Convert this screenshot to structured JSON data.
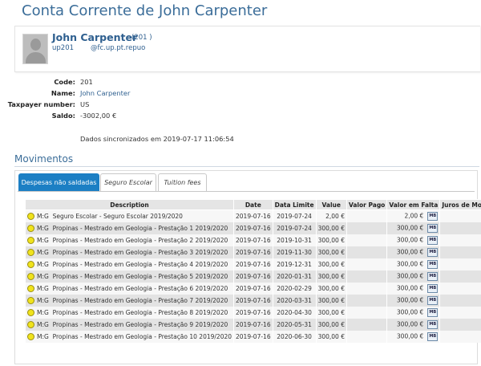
{
  "page": {
    "title": "Conta Corrente de John Carpenter"
  },
  "profile": {
    "name": "John Carpenter",
    "code": "(201          )",
    "user": "up201",
    "email": "@fc.up.pt.repuo"
  },
  "info": {
    "code_label": "Code:",
    "code_value": "201",
    "name_label": "Name:",
    "name_value": "John Carpenter",
    "tax_label": "Taxpayer number:",
    "tax_value": "US",
    "balance_label": "Saldo:",
    "balance_value": "-3002,00 €",
    "sync_text": "Dados sincronizados em 2019-07-17 11:06:54"
  },
  "movements": {
    "title": "Movimentos",
    "tabs": [
      {
        "label": "Despesas não saldadas"
      },
      {
        "label": "Seguro Escolar"
      },
      {
        "label": "Tuition fees"
      }
    ],
    "columns": [
      "Description",
      "Date",
      "Data Limite",
      "Value",
      "Valor Pago",
      "Valor em Falta",
      "Juros de Mora"
    ],
    "mb_label": "MB",
    "rows": [
      {
        "mg": "M:G",
        "desc": "Seguro Escolar - Seguro Escolar 2019/2020",
        "date": "2019-07-16",
        "limit": "2019-07-24",
        "value": "2,00 €",
        "paid": "",
        "missing": "2,00 €",
        "interest": ""
      },
      {
        "mg": "M:G",
        "desc": "Propinas - Mestrado em Geologia - Prestação 1 2019/2020",
        "date": "2019-07-16",
        "limit": "2019-07-24",
        "value": "300,00 €",
        "paid": "",
        "missing": "300,00 €",
        "interest": ""
      },
      {
        "mg": "M:G",
        "desc": "Propinas - Mestrado em Geologia - Prestação 2 2019/2020",
        "date": "2019-07-16",
        "limit": "2019-10-31",
        "value": "300,00 €",
        "paid": "",
        "missing": "300,00 €",
        "interest": ""
      },
      {
        "mg": "M:G",
        "desc": "Propinas - Mestrado em Geologia - Prestação 3 2019/2020",
        "date": "2019-07-16",
        "limit": "2019-11-30",
        "value": "300,00 €",
        "paid": "",
        "missing": "300,00 €",
        "interest": ""
      },
      {
        "mg": "M:G",
        "desc": "Propinas - Mestrado em Geologia - Prestação 4 2019/2020",
        "date": "2019-07-16",
        "limit": "2019-12-31",
        "value": "300,00 €",
        "paid": "",
        "missing": "300,00 €",
        "interest": ""
      },
      {
        "mg": "M:G",
        "desc": "Propinas - Mestrado em Geologia - Prestação 5 2019/2020",
        "date": "2019-07-16",
        "limit": "2020-01-31",
        "value": "300,00 €",
        "paid": "",
        "missing": "300,00 €",
        "interest": ""
      },
      {
        "mg": "M:G",
        "desc": "Propinas - Mestrado em Geologia - Prestação 6 2019/2020",
        "date": "2019-07-16",
        "limit": "2020-02-29",
        "value": "300,00 €",
        "paid": "",
        "missing": "300,00 €",
        "interest": ""
      },
      {
        "mg": "M:G",
        "desc": "Propinas - Mestrado em Geologia - Prestação 7 2019/2020",
        "date": "2019-07-16",
        "limit": "2020-03-31",
        "value": "300,00 €",
        "paid": "",
        "missing": "300,00 €",
        "interest": ""
      },
      {
        "mg": "M:G",
        "desc": "Propinas - Mestrado em Geologia - Prestação 8 2019/2020",
        "date": "2019-07-16",
        "limit": "2020-04-30",
        "value": "300,00 €",
        "paid": "",
        "missing": "300,00 €",
        "interest": ""
      },
      {
        "mg": "M:G",
        "desc": "Propinas - Mestrado em Geologia - Prestação 9 2019/2020",
        "date": "2019-07-16",
        "limit": "2020-05-31",
        "value": "300,00 €",
        "paid": "",
        "missing": "300,00 €",
        "interest": ""
      },
      {
        "mg": "M:G",
        "desc": "Propinas - Mestrado em Geologia - Prestação 10 2019/2020",
        "date": "2019-07-16",
        "limit": "2020-06-30",
        "value": "300,00 €",
        "paid": "",
        "missing": "300,00 €",
        "interest": ""
      }
    ]
  },
  "colors": {
    "accent": "#1c7fc4",
    "title": "#3b6d99",
    "link": "#2e5f8f",
    "status_dot": "#f0e31c"
  },
  "icons": {
    "status": "yellow-circle-icon",
    "payment": "mb-icon",
    "avatar": "user-placeholder-icon"
  }
}
